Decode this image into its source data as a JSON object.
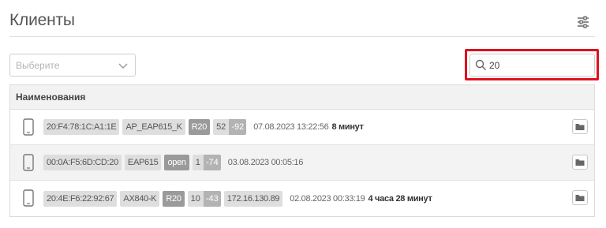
{
  "header": {
    "title": "Клиенты",
    "settings_icon": "sliders-icon"
  },
  "filter": {
    "select_placeholder": "Выберите"
  },
  "search": {
    "value": "20",
    "highlight_color": "#e0101f"
  },
  "table": {
    "column_header": "Наименования",
    "rows": [
      {
        "mac": "20:F4:78:1C:A1:1E",
        "device": "AP_EAP615_K",
        "band": "R20",
        "signal_a": "52",
        "signal_b": "-92",
        "ip": "",
        "date": "07.08.2023 13:22:56",
        "duration": "8 минут"
      },
      {
        "mac": "00:0A:F5:6D:CD:20",
        "device": "EAP615",
        "band": "open",
        "signal_a": "1",
        "signal_b": "-74",
        "ip": "",
        "date": "03.08.2023 00:05:16",
        "duration": ""
      },
      {
        "mac": "20:4E:F6:22:92:67",
        "device": "AX840-K",
        "band": "R20",
        "signal_a": "10",
        "signal_b": "-43",
        "ip": "172.16.130.89",
        "date": "02.08.2023 00:33:19",
        "duration": "4 часа 28 минут"
      }
    ]
  }
}
